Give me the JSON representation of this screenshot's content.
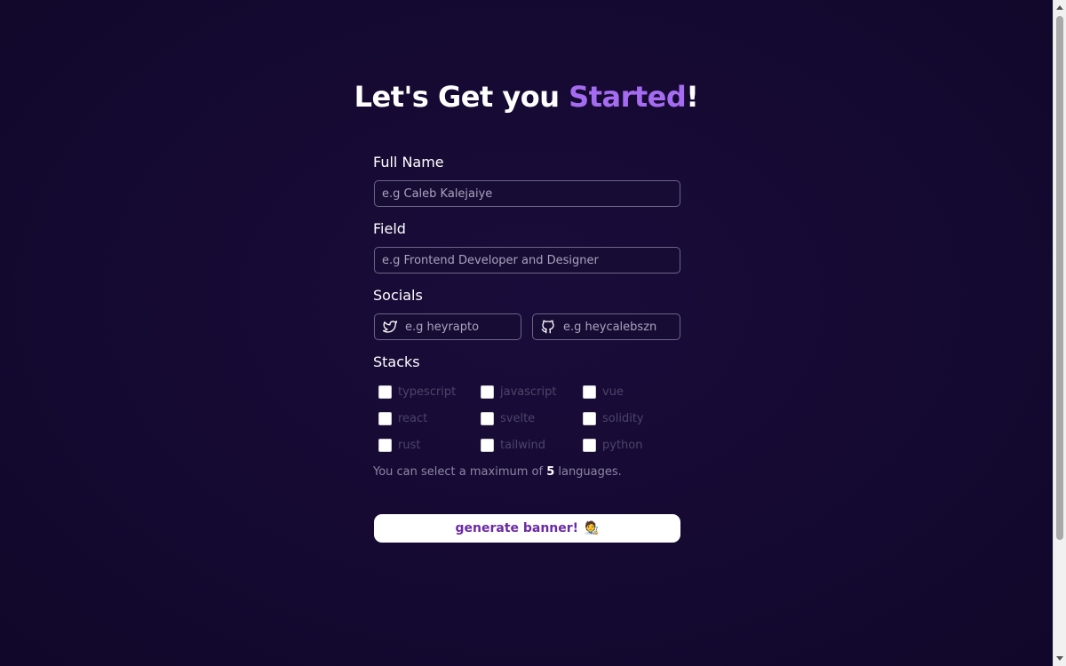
{
  "title": {
    "prefix": "Let's Get you ",
    "accent": "Started",
    "suffix": "!"
  },
  "colors": {
    "accent": "#a56bf0",
    "background": "#160a33",
    "button_text": "#6a2aa6"
  },
  "form": {
    "full_name": {
      "label": "Full Name",
      "placeholder": "e.g Caleb Kalejaiye",
      "value": ""
    },
    "field": {
      "label": "Field",
      "placeholder": "e.g Frontend Developer and Designer",
      "value": ""
    },
    "socials": {
      "label": "Socials",
      "twitter": {
        "icon": "twitter-icon",
        "placeholder": "e.g heyrapto",
        "value": ""
      },
      "github": {
        "icon": "github-icon",
        "placeholder": "e.g heycalebszn",
        "value": ""
      }
    },
    "stacks": {
      "label": "Stacks",
      "items": [
        {
          "name": "typescript",
          "checked": false
        },
        {
          "name": "javascript",
          "checked": false
        },
        {
          "name": "vue",
          "checked": false
        },
        {
          "name": "react",
          "checked": false
        },
        {
          "name": "svelte",
          "checked": false
        },
        {
          "name": "solidity",
          "checked": false
        },
        {
          "name": "rust",
          "checked": false
        },
        {
          "name": "tailwind",
          "checked": false
        },
        {
          "name": "python",
          "checked": false
        }
      ],
      "note": {
        "before": "You can select a maximum of ",
        "count": "5",
        "after": " languages."
      }
    },
    "submit": {
      "label": "generate banner!",
      "emoji": "🧑‍🎨"
    }
  }
}
